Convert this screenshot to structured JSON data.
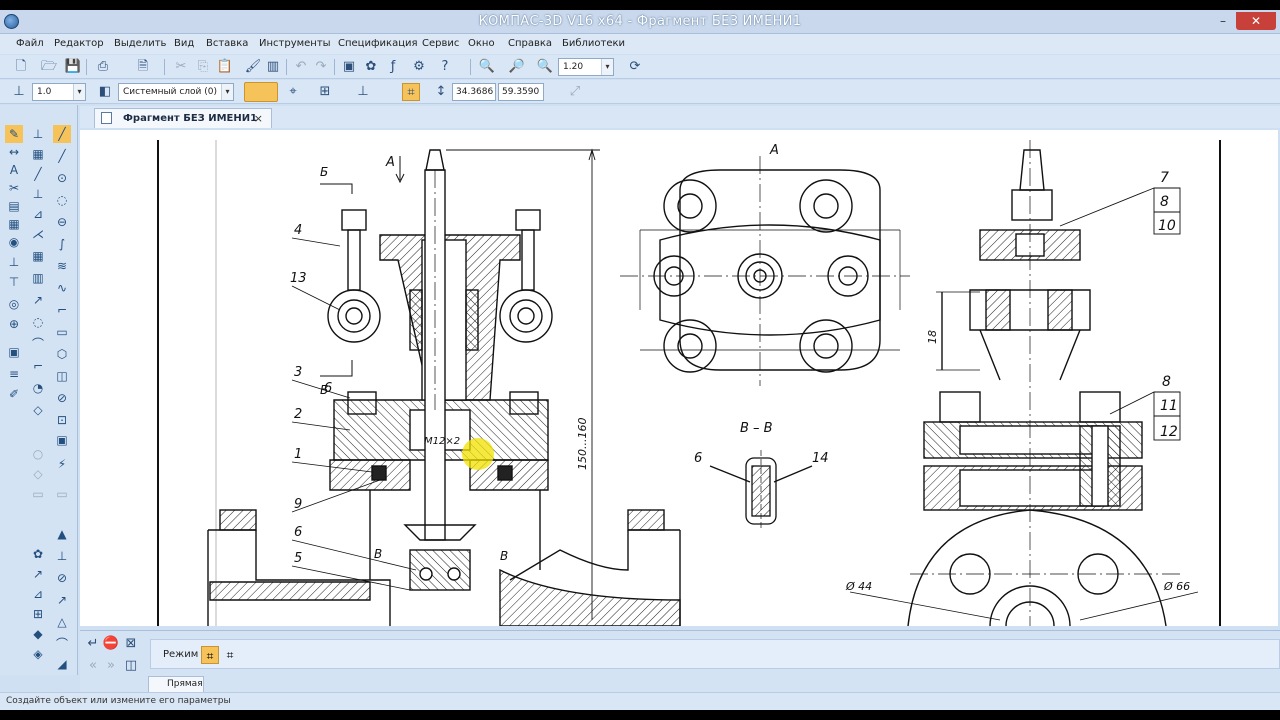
{
  "window": {
    "title": "КОМПАС-3D V16  x64 - Фрагмент БЕЗ ИМЕНИ1"
  },
  "menu": [
    "Файл",
    "Редактор",
    "Выделить",
    "Вид",
    "Вставка",
    "Инструменты",
    "Спецификация",
    "Сервис",
    "Окно",
    "Справка",
    "Библиотеки"
  ],
  "toolbar1": {
    "zoom": "1.20"
  },
  "toolbar2": {
    "line_style": "1.0",
    "layer": "Системный слой (0)",
    "coord_x": "34.3686",
    "coord_y": "59.3590"
  },
  "document": {
    "tab_label": "Фрагмент БЕЗ ИМЕНИ1",
    "close_glyph": "×"
  },
  "drawing": {
    "view_a": "А",
    "section_bb": "В – В",
    "cut_a": "А",
    "cut_b_top": "Б",
    "cut_b_bottom": "Б",
    "cut_v_left": "В",
    "cut_v_right": "В",
    "thread": "М12×2",
    "dim_height": "150...160",
    "dim_18": "18",
    "dim_d44": "Ø 44",
    "dim_d66": "Ø 66",
    "left_callouts": [
      "4",
      "13",
      "3",
      "6",
      "2",
      "1",
      "9",
      "6",
      "5"
    ],
    "bb_callouts": [
      "6",
      "14"
    ],
    "right_callouts": [
      "7",
      "8",
      "10",
      "8",
      "11",
      "12"
    ]
  },
  "properties": {
    "mode_label": "Режим",
    "tab_label": "Прямая"
  },
  "status": {
    "text": "Создайте объект или измените его параметры"
  },
  "colors": {
    "highlight": "#f2e200",
    "title_bg": "#c9d8ec",
    "panel_bg": "#d4e3f4"
  }
}
